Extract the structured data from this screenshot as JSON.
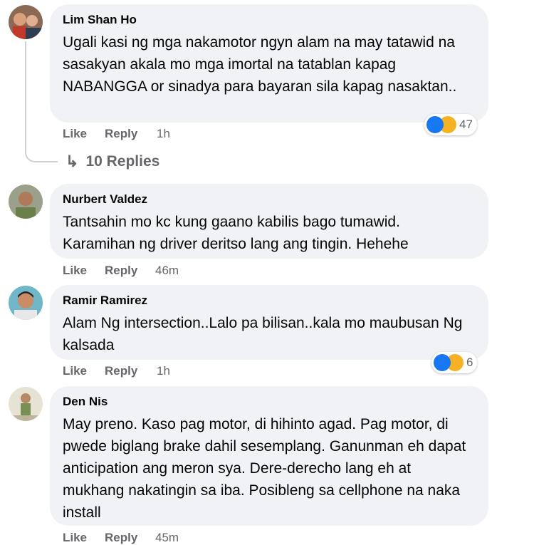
{
  "comments": [
    {
      "author": "Lim Shan Ho",
      "text": "Ugali kasi ng mga nakamotor ngyn alam na may tatawid na sasakyan akala mo mga imortal na tatablan kapag NABANGGA or sinadya para bayaran sila kapag nasaktan..",
      "like_label": "Like",
      "reply_label": "Reply",
      "time": "1h",
      "reaction_count": "47",
      "reactions": [
        "like-icon",
        "haha-icon"
      ],
      "replies_label": "10 Replies"
    },
    {
      "author": "Nurbert Valdez",
      "text": "Tantsahin mo kc kung gaano kabilis bago tumawid. Karamihan ng driver deritso lang ang tingin. Hehehe",
      "like_label": "Like",
      "reply_label": "Reply",
      "time": "46m"
    },
    {
      "author": "Ramir Ramirez",
      "text": "Alam Ng intersection..Lalo pa bilisan..kala mo maubusan Ng kalsada",
      "like_label": "Like",
      "reply_label": "Reply",
      "time": "1h",
      "reaction_count": "6",
      "reactions": [
        "like-icon",
        "haha-icon"
      ]
    },
    {
      "author": "Den Nis",
      "text": "May preno. Kaso pag motor, di hihinto agad. Pag motor, di pwede biglang brake dahil sesemplang. Ganunman eh dapat anticipation ang meron sya. Dere-derecho lang eh at mukhang nakatingin sa iba. Posibleng sa cellphone na naka install",
      "like_label": "Like",
      "reply_label": "Reply",
      "time": "45m"
    }
  ],
  "colors": {
    "bubble": "#f0f2f5",
    "secondary_text": "#65676b",
    "like_blue": "#1877f2",
    "haha_yellow": "#f7b125"
  }
}
